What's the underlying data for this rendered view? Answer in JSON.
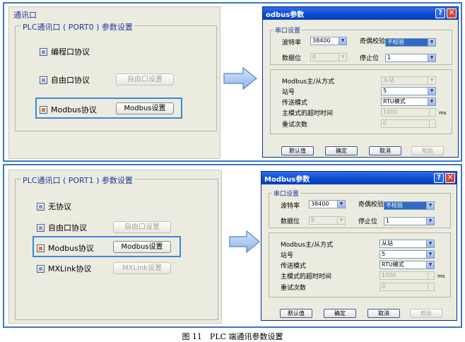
{
  "top": {
    "outer_title": "通讯口",
    "group_title": "PLC通讯口 ( PORT0 ) 参数设置",
    "options": [
      {
        "label": "编程口协议",
        "selected": false
      },
      {
        "label": "自由口协议",
        "selected": false,
        "button": "自由口设置",
        "button_enabled": false
      },
      {
        "label": "Modbus协议",
        "selected": true,
        "button": "Modbus设置",
        "button_enabled": true
      }
    ]
  },
  "bottom": {
    "group_title": "PLC通讯口 ( PORT1 ) 参数设置",
    "options": [
      {
        "label": "无协议",
        "selected": false
      },
      {
        "label": "自由口协议",
        "selected": false,
        "button": "自由口设置",
        "button_enabled": false
      },
      {
        "label": "Modbus协议",
        "selected": true,
        "button": "Modbus设置",
        "button_enabled": true
      },
      {
        "label": "MXLink协议",
        "selected": false,
        "button": "MXLink设置",
        "button_enabled": false
      }
    ]
  },
  "dialog": {
    "title": "Modbus参数",
    "help_icon": "?",
    "close_icon": "✕",
    "serial_group": "串口设置",
    "baud_label": "波特率",
    "baud_value": "38400",
    "parity_label": "奇偶校验",
    "parity_value": "不校验",
    "databits_label": "数据位",
    "databits_value": "8",
    "stopbits_label": "停止位",
    "stopbits_value": "1",
    "mode_label": "Modbus主/从方式",
    "mode_value": "从站",
    "station_label": "站号",
    "station_value": "5",
    "transfer_label": "传送模式",
    "transfer_value": "RTU模式",
    "timeout_label": "主模式的超时时间",
    "timeout_value": "1000",
    "timeout_unit": "ms",
    "retry_label": "重试次数",
    "retry_value": "0",
    "btn_default": "默认值",
    "btn_ok": "确定",
    "btn_cancel": "取消",
    "btn_help": "帮助"
  },
  "top_dialog_overrides": {
    "title": "odbus参数"
  },
  "caption": "图 11　PLC 端通讯参数设置"
}
